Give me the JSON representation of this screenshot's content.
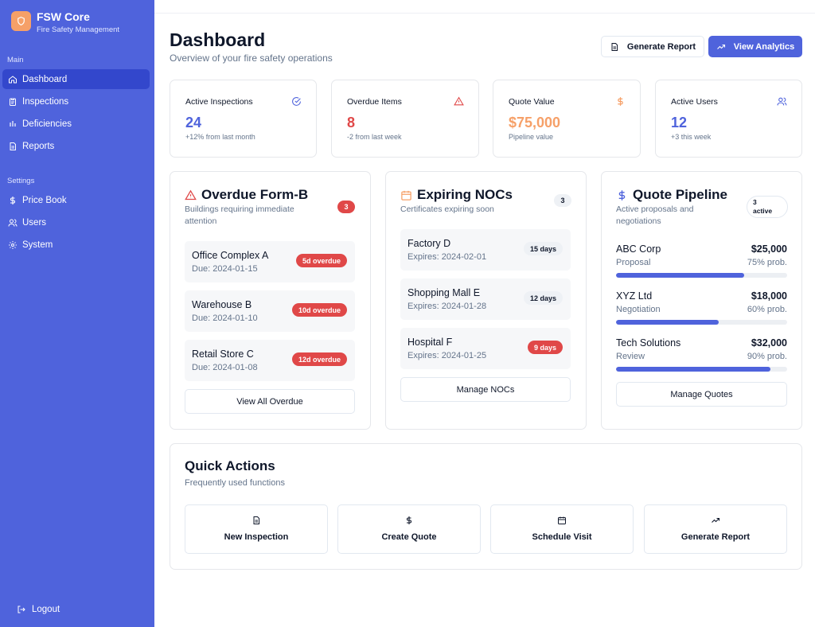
{
  "brand": {
    "title": "FSW Core",
    "subtitle": "Fire Safety Management"
  },
  "sidebar": {
    "main_label": "Main",
    "main_items": [
      {
        "label": "Dashboard",
        "icon": "home-icon",
        "active": true
      },
      {
        "label": "Inspections",
        "icon": "clipboard-icon"
      },
      {
        "label": "Deficiencies",
        "icon": "bars-icon"
      },
      {
        "label": "Reports",
        "icon": "file-icon"
      }
    ],
    "settings_label": "Settings",
    "settings_items": [
      {
        "label": "Price Book",
        "icon": "dollar-icon"
      },
      {
        "label": "Users",
        "icon": "users-icon"
      },
      {
        "label": "System",
        "icon": "gear-icon"
      }
    ],
    "logout": "Logout"
  },
  "header": {
    "title": "Dashboard",
    "subtitle": "Overview of your fire safety operations",
    "generate_report": "Generate Report",
    "view_analytics": "View Analytics"
  },
  "stats": [
    {
      "label": "Active Inspections",
      "value": "24",
      "note": "+12% from last month",
      "color": "#4f63dc",
      "icon": "check-circle-icon"
    },
    {
      "label": "Overdue Items",
      "value": "8",
      "note": "-2 from last week",
      "color": "#e04848",
      "icon": "alert-triangle-icon"
    },
    {
      "label": "Quote Value",
      "value": "$75,000",
      "note": "Pipeline value",
      "color": "#f6a068",
      "icon": "dollar-icon"
    },
    {
      "label": "Active Users",
      "value": "12",
      "note": "+3 this week",
      "color": "#4f63dc",
      "icon": "users-icon"
    }
  ],
  "overdue": {
    "title": "Overdue Form-B",
    "subtitle_1": "Buildings requiring immediate",
    "subtitle_2": "attention",
    "count": "3",
    "items": [
      {
        "name": "Office Complex A",
        "due": "Due: 2024-01-15",
        "badge": "5d overdue"
      },
      {
        "name": "Warehouse B",
        "due": "Due: 2024-01-10",
        "badge": "10d overdue"
      },
      {
        "name": "Retail Store C",
        "due": "Due: 2024-01-08",
        "badge": "12d overdue"
      }
    ],
    "button": "View All Overdue"
  },
  "nocs": {
    "title": "Expiring NOCs",
    "subtitle": "Certificates expiring soon",
    "count": "3",
    "items": [
      {
        "name": "Factory D",
        "expires": "Expires: 2024-02-01",
        "badge": "15 days",
        "urgent": false
      },
      {
        "name": "Shopping Mall E",
        "expires": "Expires: 2024-01-28",
        "badge": "12 days",
        "urgent": false
      },
      {
        "name": "Hospital F",
        "expires": "Expires: 2024-01-25",
        "badge": "9 days",
        "urgent": true
      }
    ],
    "button": "Manage NOCs"
  },
  "quotes": {
    "title": "Quote Pipeline",
    "subtitle_1": "Active proposals and",
    "subtitle_2": "negotiations",
    "badge_1": "3",
    "badge_2": "active",
    "items": [
      {
        "name": "ABC Corp",
        "amount": "$25,000",
        "stage": "Proposal",
        "prob_label": "75% prob.",
        "prob": 0.75
      },
      {
        "name": "XYZ Ltd",
        "amount": "$18,000",
        "stage": "Negotiation",
        "prob_label": "60% prob.",
        "prob": 0.6
      },
      {
        "name": "Tech Solutions",
        "amount": "$32,000",
        "stage": "Review",
        "prob_label": "90% prob.",
        "prob": 0.9
      }
    ],
    "button": "Manage Quotes"
  },
  "quick_actions": {
    "title": "Quick Actions",
    "subtitle": "Frequently used functions",
    "items": [
      {
        "label": "New Inspection",
        "icon": "file-icon"
      },
      {
        "label": "Create Quote",
        "icon": "dollar-icon"
      },
      {
        "label": "Schedule Visit",
        "icon": "calendar-icon"
      },
      {
        "label": "Generate Report",
        "icon": "trending-up-icon"
      }
    ]
  },
  "colors": {
    "primary": "#4f63dc",
    "danger": "#e04848",
    "warning": "#f6a068"
  }
}
